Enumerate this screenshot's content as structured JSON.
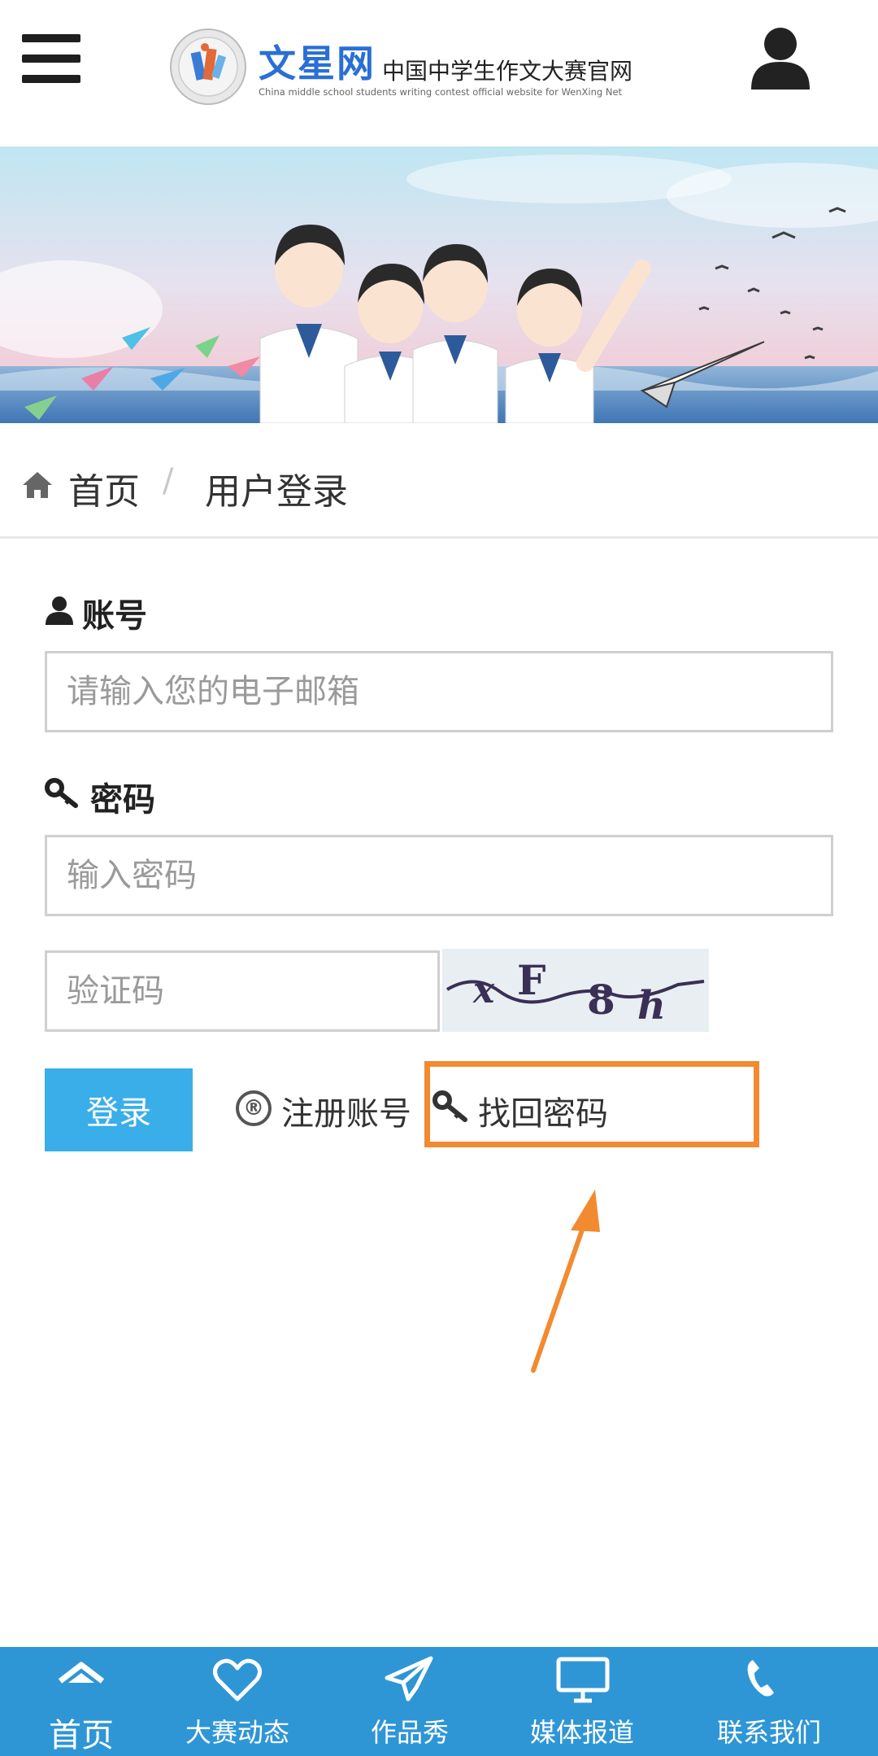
{
  "header": {
    "logo_title": "文星网",
    "logo_subtitle": "中国中学生作文大赛官网",
    "logo_english": "China middle school students writing contest official website for WenXing Net"
  },
  "breadcrumb": {
    "home": "首页",
    "separator": "/",
    "current": "用户登录"
  },
  "form": {
    "account_label": "账号",
    "account_placeholder": "请输入您的电子邮箱",
    "password_label": "密码",
    "password_placeholder": "输入密码",
    "captcha_placeholder": "验证码",
    "captcha_text": "xF8h",
    "login_button": "登录",
    "register_link": "注册账号",
    "register_icon": "®",
    "recover_link": "找回密码"
  },
  "bottom_nav": {
    "items": [
      {
        "label": "首页",
        "icon": "home-icon"
      },
      {
        "label": "大赛动态",
        "icon": "heart-icon"
      },
      {
        "label": "作品秀",
        "icon": "paper-plane-icon"
      },
      {
        "label": "媒体报道",
        "icon": "monitor-icon"
      },
      {
        "label": "联系我们",
        "icon": "phone-icon"
      }
    ]
  },
  "colors": {
    "brand_blue": "#2a6fd6",
    "button_blue": "#3aaee8",
    "nav_blue": "#2f96d5",
    "highlight_orange": "#f28a30"
  }
}
